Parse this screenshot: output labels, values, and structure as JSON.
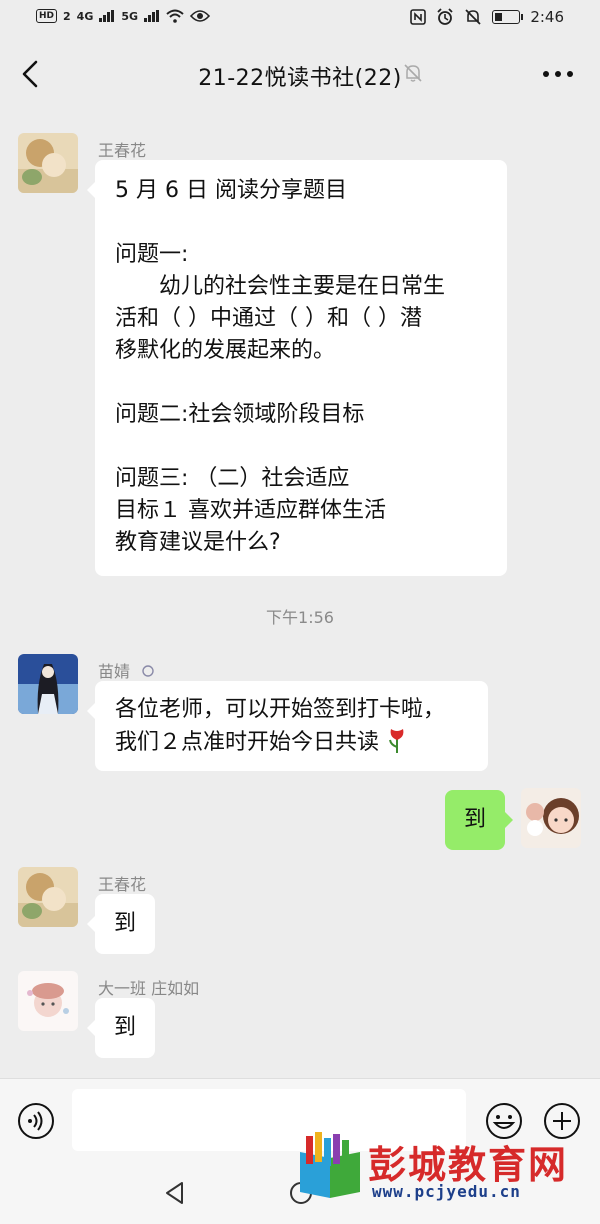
{
  "status_bar": {
    "left_indicators": [
      "HD",
      "2",
      "4G",
      "5G"
    ],
    "time": "2:46",
    "battery_level": 0.3
  },
  "nav": {
    "title": "21-22悦读书社(22)"
  },
  "messages": [
    {
      "sender": "王春花",
      "lines": [
        "5 月 6 日  阅读分享题目",
        "",
        "问题一:",
        "　　幼儿的社会性主要是在日常生",
        "活和（  ）中通过（  ）和（  ）潜",
        "移默化的发展起来的。",
        "",
        "问题二:社会领域阶段目标",
        "",
        "问题三:  （二）社会适应",
        "目标１  喜欢并适应群体生活",
        "教育建议是什么?"
      ]
    },
    {
      "time": "下午1:56"
    },
    {
      "sender": "苗婧",
      "lines": [
        "各位老师，可以开始签到打卡啦，",
        "我们２点准时开始今日共读"
      ]
    },
    {
      "mine": true,
      "text": "到"
    },
    {
      "sender": "王春花",
      "text": "到"
    },
    {
      "sender": "大一班  庄如如",
      "text": "到"
    }
  ],
  "watermark": {
    "name": "彭城教育网",
    "url": "www.pcjyedu.cn"
  },
  "colors": {
    "background": "#ededed",
    "bubble_mine": "#95ec69",
    "bubble_other": "#ffffff",
    "watermark_red": "#d62a2a"
  }
}
